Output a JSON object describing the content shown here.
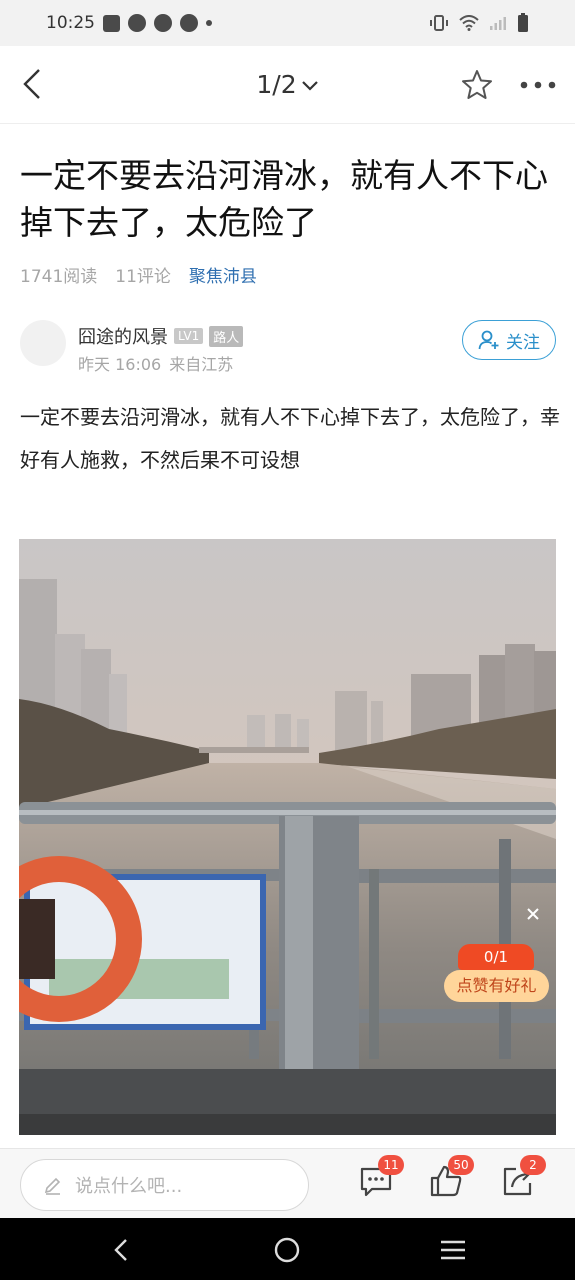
{
  "status_bar": {
    "time": "10:25"
  },
  "header": {
    "page_indicator": "1/2"
  },
  "article": {
    "title": "一定不要去沿河滑冰，就有人不下心掉下去了，太危险了",
    "reads": "1741阅读",
    "comments": "11评论",
    "topic": "聚焦沛县",
    "author": {
      "name": "囧途的风景",
      "level": "LV1",
      "tag": "路人",
      "time": "昨天 16:06",
      "source": "来自江苏",
      "follow_label": "关注"
    },
    "body": "一定不要去沿河滑冰，就有人不下心掉下去了，太危险了，幸好有人施救，不然后果不可设想"
  },
  "promo": {
    "count": "0/1",
    "label": "点赞有好礼"
  },
  "bottom_bar": {
    "comment_placeholder": "说点什么吧...",
    "comment_count": "11",
    "like_count": "50",
    "share_count": "2"
  },
  "colors": {
    "accent": "#2f6fb0",
    "follow": "#2a8fca",
    "badge_red": "#f05040",
    "promo_orange": "#ef4a24"
  },
  "icons": [
    "back-icon",
    "chevron-down-icon",
    "star-icon",
    "more-icon",
    "add-user-icon",
    "pencil-icon",
    "comment-icon",
    "thumbs-up-icon",
    "share-icon"
  ]
}
